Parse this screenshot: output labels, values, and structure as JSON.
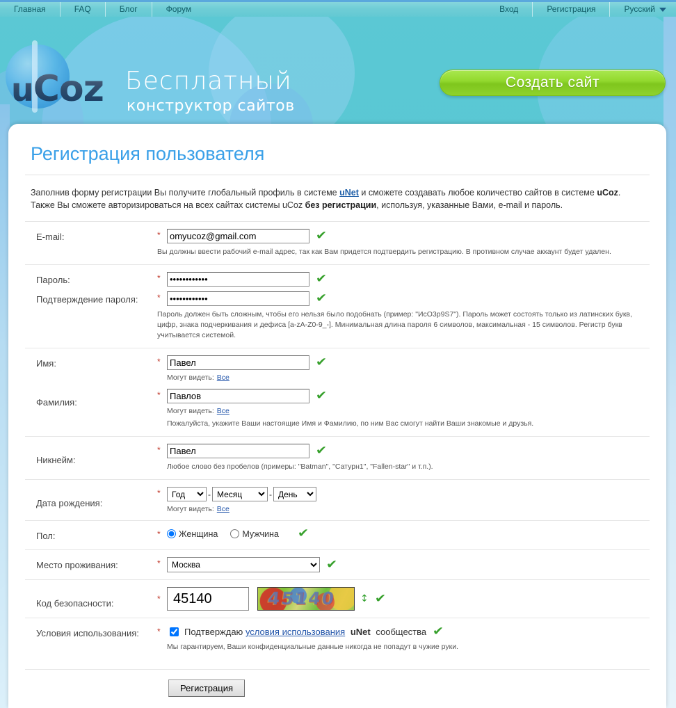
{
  "topnav": {
    "left_links": [
      {
        "label": "Главная"
      },
      {
        "label": "FAQ"
      },
      {
        "label": "Блог"
      },
      {
        "label": "Форум"
      }
    ],
    "right_links": [
      {
        "label": "Вход"
      },
      {
        "label": "Регистрация"
      }
    ],
    "language": "Русский"
  },
  "header": {
    "logo_u": "u",
    "logo_coz": "Coz",
    "slogan_line1": "Бесплатный",
    "slogan_line2": "конструктор сайтов",
    "cta_label": "Создать сайт"
  },
  "page": {
    "title": "Регистрация пользователя",
    "intro_part1": "Заполнив форму регистрации Вы получите глобальный профиль в системе ",
    "intro_link": "uNet",
    "intro_part2": " и сможете создавать любое количество сайтов в системе ",
    "intro_bold1": "uCoz",
    "intro_part3": ". Также Вы сможете авторизироваться на всех сайтах системы uCoz ",
    "intro_bold2": "без регистрации",
    "intro_part4": ", используя, указанные Вами, e-mail и пароль."
  },
  "form": {
    "email": {
      "label": "E-mail:",
      "value": "omyucoz@gmail.com",
      "placeholder": "",
      "hint": "Вы должны ввести рабочий e-mail адрес, так как Вам придется подтвердить регистрацию. В противном случае аккаунт будет удален."
    },
    "password": {
      "label": "Пароль:",
      "value": "••••••••••••",
      "confirm_label": "Подтверждение пароля:",
      "confirm_value": "••••••••••••",
      "hint": "Пароль должен быть сложным, чтобы его нельзя было подобнать (пример: \"ИсО3р9S7\"). Пароль может состоять только из латинских букв, цифр, знака подчеркивания и дефиса [a-zA-Z0-9_-]. Минимальная длина пароля 6 символов, максимальная - 15 символов. Регистр букв учитывается системой."
    },
    "firstname": {
      "label": "Имя:",
      "value": "Павел",
      "see_label": "Могут видеть:",
      "see_value": "Все"
    },
    "lastname": {
      "label": "Фамилия:",
      "value": "Павлов",
      "see_label": "Могут видеть:",
      "see_value": "Все",
      "hint": "Пожалуйста, укажите Ваши настоящие Имя и Фамилию, по ним Вас смогут найти Ваши знакомые и друзья."
    },
    "nickname": {
      "label": "Никнейм:",
      "value": "Павел",
      "hint": "Любое слово без пробелов (примеры: \"Batman\", \"Сатурн1\", \"Fallen-star\" и т.п.)."
    },
    "birthdate": {
      "label": "Дата рождения:",
      "year": "Год",
      "month": "Месяц",
      "day": "День",
      "separator": "-",
      "see_label": "Могут видеть:",
      "see_value": "Все"
    },
    "gender": {
      "label": "Пол:",
      "female": "Женщина",
      "male": "Мужчина",
      "selected": "female"
    },
    "city": {
      "label": "Место проживания:",
      "value": "Москва"
    },
    "captcha": {
      "label": "Код безопасности:",
      "value": "45140",
      "image_text": "45140",
      "refresh_icon": "refresh-icon"
    },
    "terms": {
      "label": "Условия использования:",
      "checked": true,
      "prefix": "Подтверждаю",
      "link": "условия использования",
      "brand": "uNet",
      "suffix": "сообщества",
      "hint": "Мы гарантируем, Ваши конфиденциальные данные никогда не попадут в чужие руки."
    },
    "submit_label": "Регистрация",
    "required_marker": "*",
    "ok_marker": "✔"
  }
}
